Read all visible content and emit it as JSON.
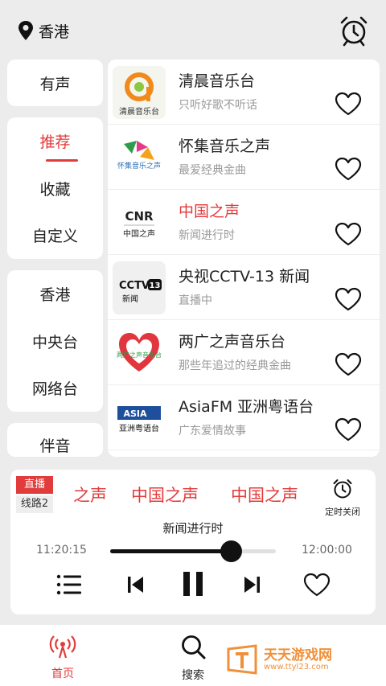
{
  "header": {
    "location": "香港",
    "location_icon": "map-pin-icon",
    "alarm_icon": "alarm-clock-icon"
  },
  "sidebar": {
    "group1": [
      "有声"
    ],
    "group2": [
      "推荐",
      "收藏",
      "自定义"
    ],
    "group3": [
      "香港",
      "中央台",
      "网络台"
    ],
    "group4": [
      "伴音"
    ],
    "active": "推荐"
  },
  "stations": [
    {
      "title": "清晨音乐台",
      "subtitle": "只听好歌不听话",
      "logo_text": "清晨音乐台",
      "highlight": false
    },
    {
      "title": "怀集音乐之声",
      "subtitle": "最爱经典金曲",
      "logo_text": "怀集音乐之声",
      "highlight": false
    },
    {
      "title": "中国之声",
      "subtitle": "新闻进行时",
      "logo_text": "CNR",
      "logo_sub": "中国之声",
      "highlight": true
    },
    {
      "title": "央视CCTV-13 新闻",
      "subtitle": "直播中",
      "logo_text": "CCTV",
      "logo_badge": "13",
      "logo_sub": "新闻",
      "highlight": false
    },
    {
      "title": "两广之声音乐台",
      "subtitle": "那些年追过的经典金曲",
      "logo_text": "两广之声音乐台",
      "highlight": false
    },
    {
      "title": "AsiaFM 亚洲粤语台",
      "subtitle": "广东爱情故事",
      "logo_text": "ASIA",
      "logo_sub": "亚洲粤语台",
      "highlight": false
    }
  ],
  "player": {
    "live_label": "直播",
    "line_label": "线路2",
    "marquee": [
      "之声",
      "中国之声",
      "中国之声"
    ],
    "timer_label": "定时关闭",
    "current_program": "新闻进行时",
    "time_start": "11:20:15",
    "time_end": "12:00:00",
    "progress": 0.73
  },
  "tabs": [
    {
      "label": "首页",
      "icon": "radio-signal-icon",
      "active": true
    },
    {
      "label": "搜索",
      "icon": "search-icon",
      "active": false
    }
  ],
  "watermark": {
    "line1": "天天游戏网",
    "line2": "www.ttyl23.com"
  },
  "colors": {
    "accent": "#e23b3b",
    "background": "#ececec",
    "watermark": "#f0903a"
  }
}
